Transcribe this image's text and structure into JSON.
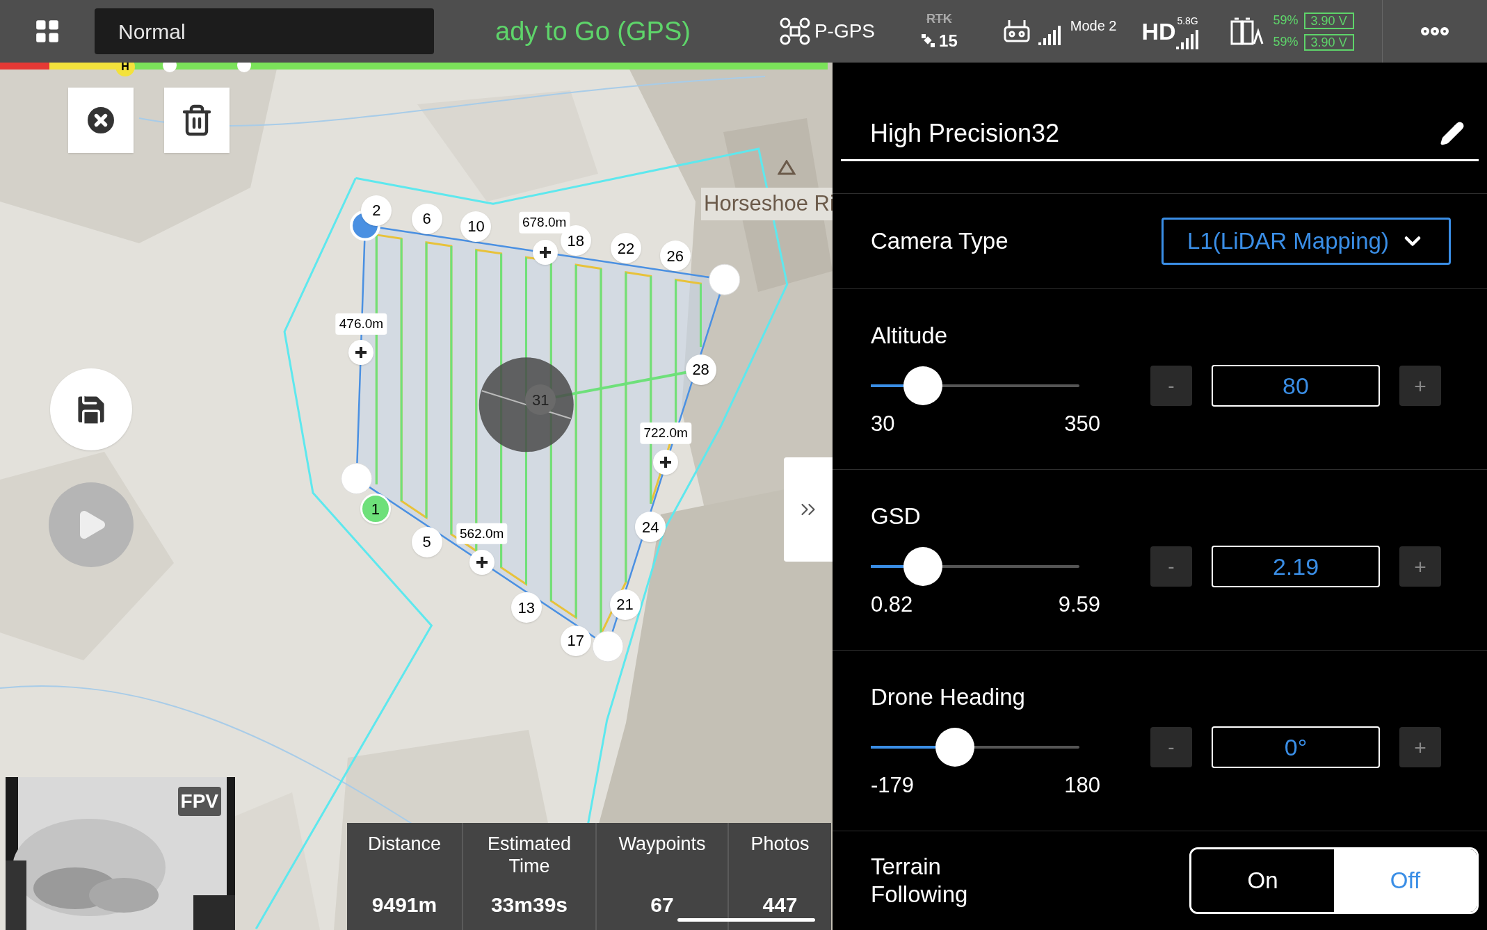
{
  "top_bar": {
    "flight_mode": "Normal",
    "status": "ady to Go (GPS)",
    "positioning": "P-GPS",
    "rtk": "RTK",
    "satellites": "15",
    "rc_mode": "Mode 2",
    "video_link": "HD",
    "video_band": "5.8G",
    "battery": [
      {
        "percent": "59%",
        "voltage": "3.90 V"
      },
      {
        "percent": "59%",
        "voltage": "3.90 V"
      }
    ]
  },
  "map": {
    "home_marker": "H",
    "place_label": "Horseshoe Ri",
    "waypoints": [
      {
        "label": "2",
        "kind": "normal"
      },
      {
        "label": "6",
        "kind": "normal"
      },
      {
        "label": "10",
        "kind": "normal"
      },
      {
        "label": "18",
        "kind": "normal"
      },
      {
        "label": "22",
        "kind": "normal"
      },
      {
        "label": "26",
        "kind": "normal"
      },
      {
        "label": "28",
        "kind": "normal"
      },
      {
        "label": "31",
        "kind": "center"
      },
      {
        "label": "24",
        "kind": "normal"
      },
      {
        "label": "21",
        "kind": "normal"
      },
      {
        "label": "17",
        "kind": "normal"
      },
      {
        "label": "13",
        "kind": "normal"
      },
      {
        "label": "5",
        "kind": "normal"
      },
      {
        "label": "1",
        "kind": "current"
      }
    ],
    "edge_lengths": [
      "678.0m",
      "476.0m",
      "722.0m",
      "562.0m"
    ]
  },
  "fpv": {
    "label": "FPV"
  },
  "stats": [
    {
      "label": "Distance",
      "value": "9491m"
    },
    {
      "label": "Estimated Time",
      "value": "33m39s"
    },
    {
      "label": "Waypoints",
      "value": "67"
    },
    {
      "label": "Photos",
      "value": "447"
    }
  ],
  "panel": {
    "title": "High Precision32",
    "camera": {
      "label": "Camera Type",
      "value": "L1(LiDAR Mapping)"
    },
    "sliders": [
      {
        "label": "Altitude",
        "min": "30",
        "max": "350",
        "level": 0.155,
        "value": "80",
        "minus": "-",
        "plus": "+"
      },
      {
        "label": "GSD",
        "min": "0.82",
        "max": "9.59",
        "level": 0.155,
        "value": "2.19",
        "minus": "-",
        "plus": "+"
      },
      {
        "label": "Drone Heading",
        "min": "-179",
        "max": "180",
        "level": 0.31,
        "value": "0°",
        "minus": "-",
        "plus": "+"
      }
    ],
    "terrain": {
      "label": "Terrain Following",
      "options": [
        {
          "label": "On",
          "selected": false
        },
        {
          "label": "Off",
          "selected": true
        }
      ]
    }
  }
}
